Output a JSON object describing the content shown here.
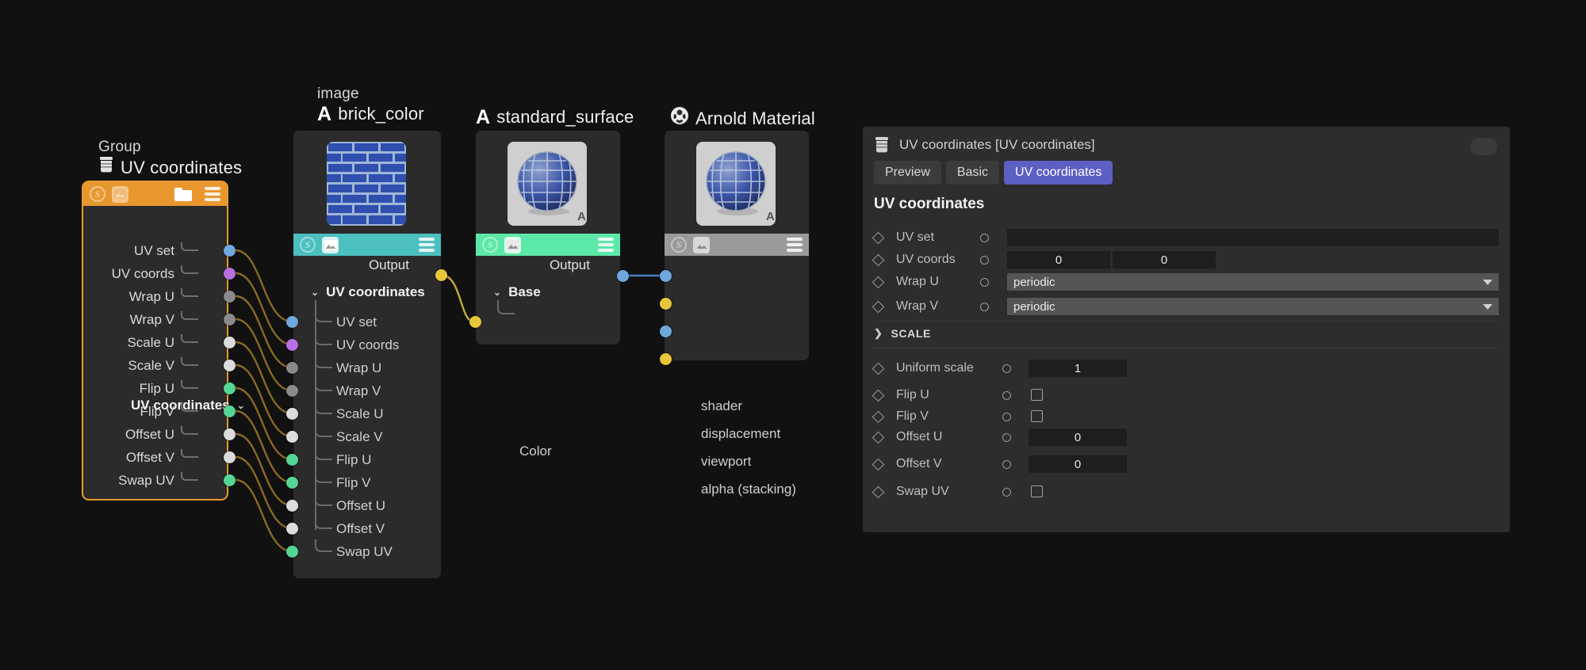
{
  "theme": {
    "background": "#111111",
    "group_accent": "#e8972f",
    "image_node_bar": "#4cbfbf",
    "surface_node_bar": "#5ce8a8",
    "material_node_bar": "#9a9a9a",
    "wire_color": "#8a6a22",
    "shader_wire": "#4a7fc1",
    "tab_active": "#5c5fc4"
  },
  "graph": {
    "group_node": {
      "subtitle": "Group",
      "title": "UV coordinates",
      "icon": "jar-icon",
      "header_icons": [
        "s-icon",
        "image-icon",
        "folder-icon",
        "hamburger-icon"
      ],
      "section_label": "UV coordinates",
      "ports": [
        {
          "label": "UV set",
          "color": "#6ea8dc"
        },
        {
          "label": "UV coords",
          "color": "#b96fe0"
        },
        {
          "label": "Wrap U",
          "color": "#8a8a8a"
        },
        {
          "label": "Wrap V",
          "color": "#8a8a8a"
        },
        {
          "label": "Scale U",
          "color": "#dcdcdc"
        },
        {
          "label": "Scale V",
          "color": "#dcdcdc"
        },
        {
          "label": "Flip U",
          "color": "#55d695"
        },
        {
          "label": "Flip V",
          "color": "#55d695"
        },
        {
          "label": "Offset U",
          "color": "#dcdcdc"
        },
        {
          "label": "Offset V",
          "color": "#dcdcdc"
        },
        {
          "label": "Swap UV",
          "color": "#55d695"
        }
      ]
    },
    "image_node": {
      "subtitle": "image",
      "title": "brick_color",
      "prefix_icon": "arnold-a-icon",
      "thumbnail": "brick-texture-thumbnail",
      "bar_color": "#4cbfbf",
      "header_icons": [
        "s-icon",
        "image-icon",
        "hamburger-icon"
      ],
      "output_label": "Output",
      "output_dot_color": "#e8c63a",
      "section_label": "UV coordinates",
      "inputs": [
        {
          "label": "UV set",
          "color": "#6ea8dc"
        },
        {
          "label": "UV coords",
          "color": "#b96fe0"
        },
        {
          "label": "Wrap U",
          "color": "#8a8a8a"
        },
        {
          "label": "Wrap V",
          "color": "#8a8a8a"
        },
        {
          "label": "Scale U",
          "color": "#dcdcdc"
        },
        {
          "label": "Scale V",
          "color": "#dcdcdc"
        },
        {
          "label": "Flip U",
          "color": "#55d695"
        },
        {
          "label": "Flip V",
          "color": "#55d695"
        },
        {
          "label": "Offset U",
          "color": "#dcdcdc"
        },
        {
          "label": "Offset V",
          "color": "#dcdcdc"
        },
        {
          "label": "Swap UV",
          "color": "#55d695"
        }
      ]
    },
    "surface_node": {
      "title": "standard_surface",
      "prefix_icon": "arnold-a-icon",
      "thumbnail": "brick-sphere-thumbnail",
      "bar_color": "#5ce8a8",
      "header_icons": [
        "s-icon",
        "image-icon",
        "hamburger-icon"
      ],
      "output_label": "Output",
      "output_dot_color": "#6ea8dc",
      "section_label": "Base",
      "inputs": [
        {
          "label": "Color",
          "color": "#e8c63a"
        }
      ]
    },
    "material_node": {
      "title": "Arnold Material",
      "prefix_icon": "arnold-logo-icon",
      "thumbnail": "brick-sphere-thumbnail",
      "bar_color": "#9a9a9a",
      "header_icons": [
        "s-icon",
        "image-icon",
        "hamburger-icon"
      ],
      "inputs": [
        {
          "label": "shader",
          "color": "#6ea8dc"
        },
        {
          "label": "displacement",
          "color": "#e8c63a"
        },
        {
          "label": "viewport",
          "color": "#6ea8dc"
        },
        {
          "label": "alpha (stacking)",
          "color": "#e8c63a"
        }
      ]
    }
  },
  "panel": {
    "icon": "jar-icon",
    "title": "UV coordinates [UV coordinates]",
    "tabs": [
      {
        "label": "Preview",
        "active": false
      },
      {
        "label": "Basic",
        "active": false
      },
      {
        "label": "UV coordinates",
        "active": true
      }
    ],
    "section_title": "UV coordinates",
    "rows": [
      {
        "name": "UV set",
        "widget": "text",
        "value": ""
      },
      {
        "name": "UV coords",
        "widget": "pair",
        "value": "0",
        "value2": "0"
      },
      {
        "name": "Wrap U",
        "widget": "combo",
        "value": "periodic"
      },
      {
        "name": "Wrap V",
        "widget": "combo",
        "value": "periodic"
      }
    ],
    "group": {
      "label": "SCALE",
      "expanded": false,
      "chevron": "chevron-right-icon"
    },
    "rows2": [
      {
        "name": "Uniform scale",
        "widget": "number",
        "value": "1"
      },
      {
        "name": "Flip U",
        "widget": "checkbox",
        "checked": false
      },
      {
        "name": "Flip V",
        "widget": "checkbox",
        "checked": false
      },
      {
        "name": "Offset U",
        "widget": "number",
        "value": "0"
      },
      {
        "name": "Offset V",
        "widget": "number",
        "value": "0"
      },
      {
        "name": "Swap UV",
        "widget": "checkbox",
        "checked": false
      }
    ]
  }
}
